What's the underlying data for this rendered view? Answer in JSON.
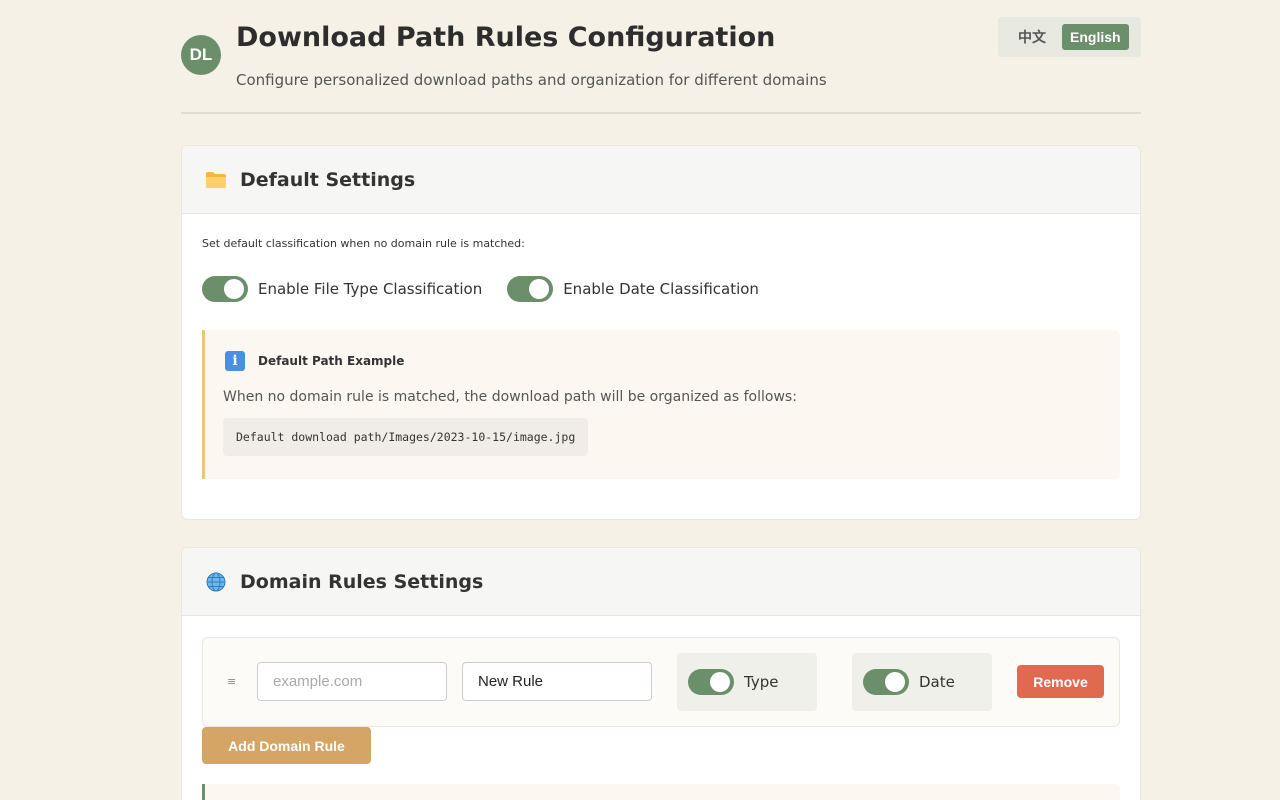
{
  "header": {
    "logo_text": "DL",
    "title": "Download Path Rules Configuration",
    "subtitle": "Configure personalized download paths and organization for different domains",
    "languages": [
      {
        "label": "中文",
        "active": false
      },
      {
        "label": "English",
        "active": true
      }
    ]
  },
  "default_settings": {
    "icon": "folder-icon",
    "title": "Default Settings",
    "description": "Set default classification when no domain rule is matched:",
    "toggles": [
      {
        "label": "Enable File Type Classification",
        "enabled": true
      },
      {
        "label": "Enable Date Classification",
        "enabled": true
      }
    ],
    "example": {
      "icon": "info-icon",
      "title": "Default Path Example",
      "text": "When no domain rule is matched, the download path will be organized as follows:",
      "code": "Default download path/Images/2023-10-15/image.jpg"
    }
  },
  "domain_rules": {
    "icon": "globe-icon",
    "title": "Domain Rules Settings",
    "rules": [
      {
        "drag_handle": "≡",
        "domain_value": "",
        "domain_placeholder": "example.com",
        "name_value": "New Rule",
        "type_label": "Type",
        "type_enabled": true,
        "date_label": "Date",
        "date_enabled": true,
        "remove_label": "Remove"
      }
    ],
    "add_label": "Add Domain Rule"
  },
  "colors": {
    "accent": "#6b8e6b",
    "remove": "#e06a4f",
    "add": "#d4a564",
    "background": "#f5f1e6"
  }
}
